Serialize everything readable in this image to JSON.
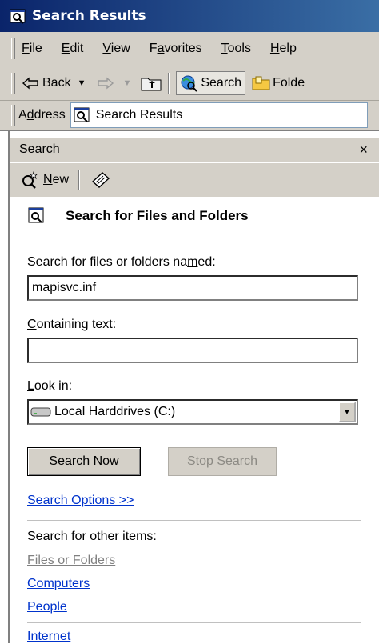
{
  "window": {
    "title": "Search Results"
  },
  "menu": [
    "File",
    "Edit",
    "View",
    "Favorites",
    "Tools",
    "Help"
  ],
  "toolbar": {
    "back_label": "Back",
    "search_label": "Search",
    "folders_label": "Folde"
  },
  "address": {
    "label": "Address",
    "value": "Search Results"
  },
  "search_pane": {
    "header": "Search",
    "close_glyph": "×",
    "new_label": "New",
    "heading": "Search for Files and Folders",
    "named_label": "Search for files or folders named:",
    "named_value": "mapisvc.inf",
    "containing_label": "Containing text:",
    "containing_value": "",
    "lookin_label": "Look in:",
    "lookin_value": "Local Harddrives (C:)",
    "search_now_label": "Search Now",
    "stop_search_label": "Stop Search",
    "options_link": "Search Options >>",
    "other_items_label": "Search for other items:",
    "other_items": [
      "Files or Folders",
      "Computers",
      "People",
      "Internet"
    ]
  },
  "colors": {
    "titlebar_start": "#0a246a",
    "titlebar_end": "#3a6ea5",
    "link": "#0033cc",
    "chrome": "#d4d0c8"
  }
}
